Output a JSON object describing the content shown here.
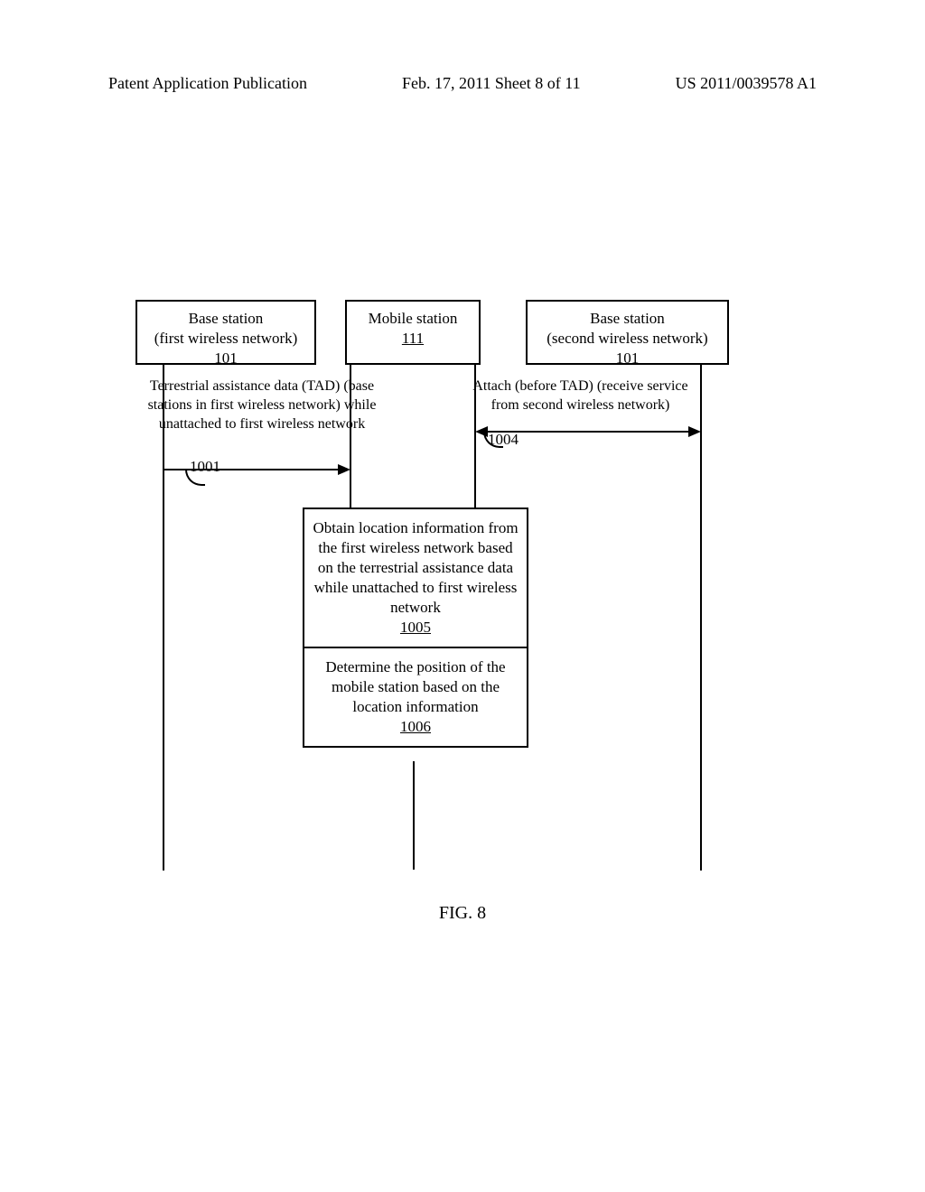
{
  "header": {
    "left": "Patent Application Publication",
    "center": "Feb. 17, 2011  Sheet 8 of 11",
    "right": "US 2011/0039578 A1"
  },
  "boxes": {
    "left": {
      "line1": "Base station",
      "line2": "(first wireless network)",
      "ref": "101"
    },
    "mid": {
      "line1": "Mobile station",
      "ref": "111"
    },
    "right": {
      "line1": "Base station",
      "line2": "(second wireless network)",
      "ref": "101"
    }
  },
  "messages": {
    "tad": "Terrestrial assistance data (TAD) (base stations in first wireless network) while unattached to first wireless network",
    "attach": "Attach (before TAD) (receive service from second wireless network)"
  },
  "callouts": {
    "c1001": "1001",
    "c1004": "1004"
  },
  "process": {
    "p1005": {
      "text": "Obtain location information from the first wireless network based on the terrestrial assistance data while unattached to first wireless network",
      "ref": "1005"
    },
    "p1006": {
      "text": "Determine the position of the mobile station based on the location information",
      "ref": "1006"
    }
  },
  "figure_label": "FIG. 8"
}
